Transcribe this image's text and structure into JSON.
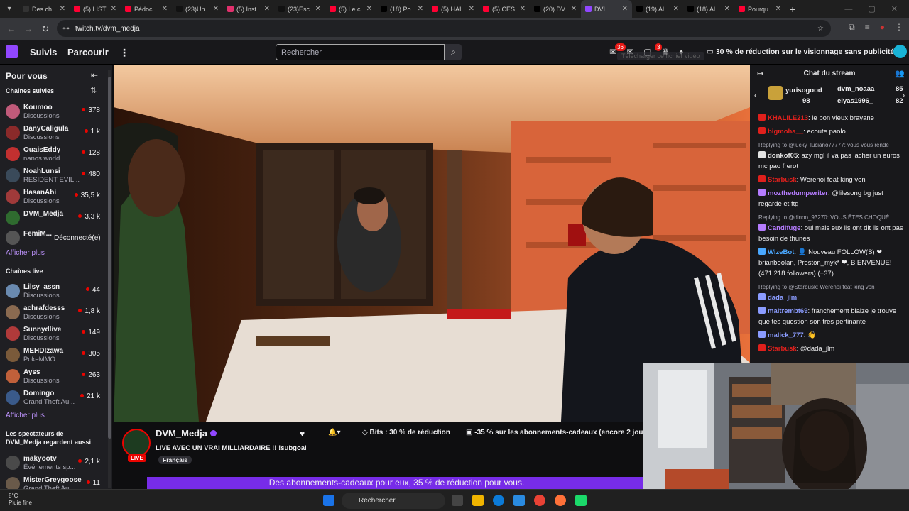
{
  "browser": {
    "tabs": [
      {
        "label": "Des ch",
        "color": "#333"
      },
      {
        "label": "(5) LIST",
        "color": "#ff0033"
      },
      {
        "label": "Pédoc",
        "color": "#ff0033"
      },
      {
        "label": "(23)Un",
        "color": "#111"
      },
      {
        "label": "(5) Inst",
        "color": "#e1306c"
      },
      {
        "label": "(23)Esc",
        "color": "#111"
      },
      {
        "label": "(5) Le c",
        "color": "#ff0033"
      },
      {
        "label": "(18) Po",
        "color": "#000"
      },
      {
        "label": "(5) HAI",
        "color": "#ff0033"
      },
      {
        "label": "(5) CES",
        "color": "#ff0033"
      },
      {
        "label": "(20) DV",
        "color": "#000"
      },
      {
        "label": "DVI",
        "color": "#9147ff"
      },
      {
        "label": "(19) Al",
        "color": "#000"
      },
      {
        "label": "(18) Al",
        "color": "#000"
      },
      {
        "label": "Pourqu",
        "color": "#ff0033"
      }
    ],
    "url": "twitch.tv/dvm_medja"
  },
  "topnav": {
    "following": "Suivis",
    "browse": "Parcourir",
    "search_placeholder": "Rechercher",
    "notif_count": "36",
    "whisper_count": "3",
    "promo": "30 % de réduction sur le visionnage sans publicités",
    "tooltip": "Télécharger ce fichier vidéo"
  },
  "sidebar": {
    "for_you": "Pour vous",
    "followed_header": "Chaînes suivies",
    "followed": [
      {
        "name": "Koumoo",
        "category": "Discussions",
        "viewers": "378",
        "color": "#c05a7a"
      },
      {
        "name": "DanyCaligula",
        "category": "Discussions",
        "viewers": "1 k",
        "color": "#8a2a2a"
      },
      {
        "name": "OuaisEddy",
        "category": "nanos world",
        "viewers": "128",
        "color": "#c23030"
      },
      {
        "name": "NoahLunsi",
        "category": "RESIDENT EVIL...",
        "viewers": "480",
        "color": "#3a4a5a"
      },
      {
        "name": "HasanAbi",
        "category": "Discussions",
        "viewers": "35,5 k",
        "color": "#a03a3a"
      },
      {
        "name": "DVM_Medja",
        "category": "",
        "viewers": "3,3 k",
        "color": "#2f6b2f"
      }
    ],
    "offline": {
      "name": "FemiM...",
      "status": "Déconnecté(e)"
    },
    "show_more_1": "Afficher plus",
    "live_header": "Chaînes live",
    "live": [
      {
        "name": "Lilsy_assn",
        "category": "Discussions",
        "viewers": "44",
        "color": "#6a8ab0"
      },
      {
        "name": "achrafdesss",
        "category": "Discussions",
        "viewers": "1,8 k",
        "color": "#8a6a50"
      },
      {
        "name": "Sunnydlive",
        "category": "Discussions",
        "viewers": "149",
        "color": "#b03a3a"
      },
      {
        "name": "MEHDIzawa",
        "category": "PokeMMO",
        "viewers": "305",
        "color": "#7a5a3a"
      },
      {
        "name": "Ayss",
        "category": "Discussions",
        "viewers": "263",
        "color": "#c0603a"
      },
      {
        "name": "Domingo",
        "category": "Grand Theft Au...",
        "viewers": "21 k",
        "color": "#3a5a8a"
      }
    ],
    "show_more_2": "Afficher plus",
    "also_watch_header": "Les spectateurs de DVM_Medja regardent aussi",
    "also_watch": [
      {
        "name": "makyootv",
        "category": "Événements sp...",
        "viewers": "2,1 k",
        "color": "#4a4a4a"
      },
      {
        "name": "MisterGreygoose",
        "category": "Grand Theft Au...",
        "viewers": "11",
        "color": "#6a5a4a"
      }
    ]
  },
  "channel": {
    "name": "DVM_Medja",
    "live_label": "LIVE",
    "title": "LIVE AVEC UN VRAI MILLIARDAIRE !! !subgoal",
    "language": "Français",
    "bits": "Bits : 30 % de réduction",
    "subs_offer": "-35 % sur les abonnements-cadeaux (encore 2 jours)",
    "banner": "Des abonnements-cadeaux pour eux, 35 % de réduction pour vous."
  },
  "chat": {
    "title": "Chat du stream",
    "gifters": [
      {
        "name": "yurisogood",
        "count": "98"
      },
      {
        "name": "dvm_noaaa",
        "count": "85"
      },
      {
        "name": "elyas1996_",
        "count": "82"
      }
    ],
    "messages": [
      {
        "reply": "",
        "user": "KHALILE213",
        "color": "#e0201c",
        "text": ": le bon vieux brayane"
      },
      {
        "reply": "",
        "user": "bigmoha__",
        "color": "#e0201c",
        "text": ": ecoute paolo"
      },
      {
        "reply": "Replying to @lucky_luciano77777: vous vous rende",
        "user": "donkof05",
        "color": "#e2e2e2",
        "text": ": azy mgl il va pas lacher un euros mc pao frerot"
      },
      {
        "reply": "",
        "user": "Starbusk",
        "color": "#e0201c",
        "text": ": Werenoi feat king von"
      },
      {
        "reply": "",
        "user": "mozthedumpwriter",
        "color": "#b57cff",
        "text": ": @lilesong bg just regarde et ftg"
      },
      {
        "reply": "Replying to @dinoo_93270: VOUS ÊTES CHOQUÉ",
        "user": "Candifuge",
        "color": "#b57cff",
        "text": ": oui mais eux ils ont dit ils ont pas besoin de thunes"
      },
      {
        "reply": "",
        "user": "WizeBot",
        "color": "#4aa8ff",
        "text": ": 👤 Nouveau FOLLOW(S) ❤ brianboolan, Preston_myk* ❤, BIENVENUE! (471 218 followers) (+37)."
      },
      {
        "reply": "Replying to @Starbusk: Werenoi feat king von",
        "user": "dada_jlm",
        "color": "#8b9cff",
        "text": ":"
      },
      {
        "reply": "",
        "user": "maitrembt69",
        "color": "#8b9cff",
        "text": ": franchement blaize je trouve que tes question son tres pertinante"
      },
      {
        "reply": "",
        "user": "malick_777",
        "color": "#8b9cff",
        "text": ": 👋"
      },
      {
        "reply": "",
        "user": "Starbusk",
        "color": "#e0201c",
        "text": ": @dada_jlm"
      }
    ]
  },
  "taskbar": {
    "temp": "8°C",
    "weather": "Pluie fine",
    "search": "Rechercher"
  }
}
